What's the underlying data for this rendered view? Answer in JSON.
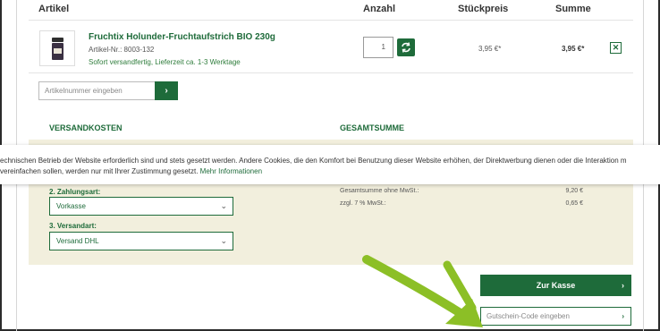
{
  "table_header": {
    "article": "Artikel",
    "quantity": "Anzahl",
    "unit_price": "Stückpreis",
    "total": "Summe"
  },
  "product": {
    "name": "Fruchtix Holunder-Fruchtaufstrich BIO 230g",
    "article_number": "Artikel-Nr.: 8003-132",
    "shipping": "Sofort versandfertig, Lieferzeit ca. 1-3 Werktage",
    "quantity": "1",
    "unit_price": "3,95 €*",
    "total_price": "3,95 €*",
    "remove_label": "✕"
  },
  "article_input": {
    "placeholder": "Artikelnummer eingeben",
    "button_label": "›"
  },
  "sections": {
    "shipping_costs": "VERSANDKOSTEN",
    "grand_total": "GESAMTSUMME"
  },
  "cookie_banner": {
    "text": "echnischen Betrieb der Website erforderlich sind und stets gesetzt werden. Andere Cookies, die den Komfort bei Benutzung dieser Website erhöhen, der Direktwerbung dienen oder die Interaktion m",
    "text_line2": " vereinfachen sollen, werden nur mit Ihrer Zustimmung gesetzt. ",
    "link": "Mehr Informationen"
  },
  "shipping_form": {
    "payment_label": "2. Zahlungsart:",
    "payment_value": "Vorkasse",
    "method_label": "3. Versandart:",
    "method_value": "Versand DHL"
  },
  "summary": {
    "net_label": "Gesamtsumme ohne MwSt.:",
    "net_value": "9,20 €",
    "vat_label": "zzgl. 7 % MwSt.:",
    "vat_value": "0,65 €"
  },
  "checkout": {
    "button_label": "Zur Kasse",
    "chevron": "›"
  },
  "coupon": {
    "placeholder": "Gutschein-Code eingeben",
    "chevron": "›"
  },
  "colors": {
    "brand_green": "#1e6b3a",
    "beige_panel": "#f2efdd",
    "annotation_arrow": "#8cbf26"
  }
}
